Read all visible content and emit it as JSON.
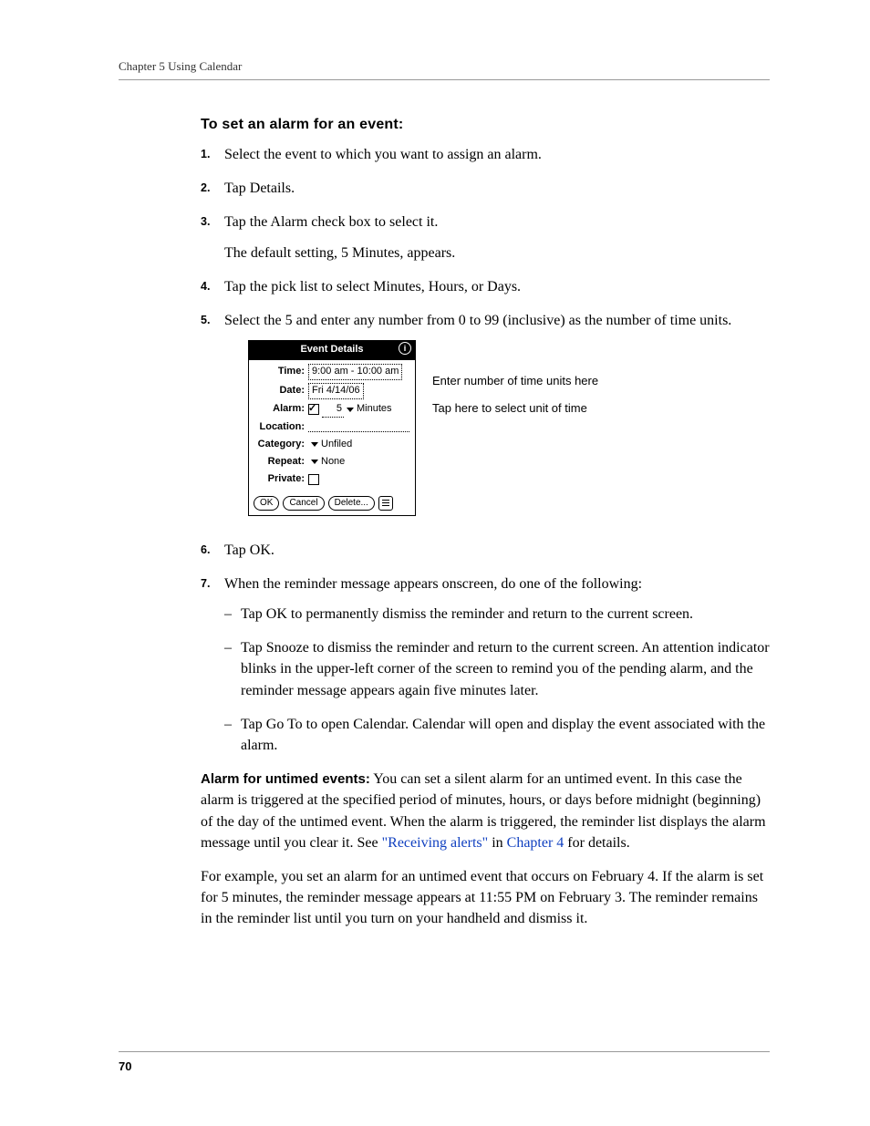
{
  "header": {
    "running": "Chapter 5    Using Calendar"
  },
  "section": {
    "title": "To set an alarm for an event:"
  },
  "steps": {
    "s1": {
      "num": "1.",
      "text": "Select the event to which you want to assign an alarm."
    },
    "s2": {
      "num": "2.",
      "text": "Tap Details."
    },
    "s3": {
      "num": "3.",
      "text": "Tap the Alarm check box to select it.",
      "follow": "The default setting, 5 Minutes, appears."
    },
    "s4": {
      "num": "4.",
      "text": "Tap the pick list to select Minutes, Hours, or Days."
    },
    "s5": {
      "num": "5.",
      "text": "Select the 5 and enter any number from 0 to 99 (inclusive) as the number of time units."
    },
    "s6": {
      "num": "6.",
      "text": "Tap OK."
    },
    "s7": {
      "num": "7.",
      "text": "When the reminder message appears onscreen, do one of the following:"
    }
  },
  "sub": {
    "a": "Tap OK to permanently dismiss the reminder and return to the current screen.",
    "b": "Tap Snooze to dismiss the reminder and return to the current screen. An attention indicator blinks in the upper-left corner of the screen to remind you of the pending alarm, and the reminder message appears again five minutes later.",
    "c": "Tap Go To to open Calendar. Calendar will open and display the event associated with the alarm."
  },
  "device": {
    "title": "Event Details",
    "info_glyph": "i",
    "time_label": "Time:",
    "time_value": "9:00 am - 10:00 am",
    "date_label": "Date:",
    "date_value": "Fri 4/14/06",
    "alarm_label": "Alarm:",
    "alarm_num": "5",
    "alarm_unit": "Minutes",
    "location_label": "Location:",
    "category_label": "Category:",
    "category_value": "Unfiled",
    "repeat_label": "Repeat:",
    "repeat_value": "None",
    "private_label": "Private:",
    "btn_ok": "OK",
    "btn_cancel": "Cancel",
    "btn_delete": "Delete..."
  },
  "callouts": {
    "c1": "Enter number of time units here",
    "c2": "Tap here to select unit of time"
  },
  "paras": {
    "p1_bold": "Alarm for untimed events:",
    "p1_rest_a": " You can set a silent alarm for an untimed event. In this case the alarm is triggered at the specified period of minutes, hours, or days before midnight (beginning) of the day of the untimed event. When the alarm is triggered, the reminder list displays the alarm message until you clear it. See ",
    "p1_link1": "\"Receiving alerts\"",
    "p1_mid": " in ",
    "p1_link2": "Chapter 4",
    "p1_end": " for details.",
    "p2": "For example, you set an alarm for an untimed event that occurs on February 4. If the alarm is set for 5 minutes, the reminder message appears at 11:55 PM on February 3. The reminder remains in the reminder list until you turn on your handheld and dismiss it."
  },
  "footer": {
    "page": "70"
  }
}
